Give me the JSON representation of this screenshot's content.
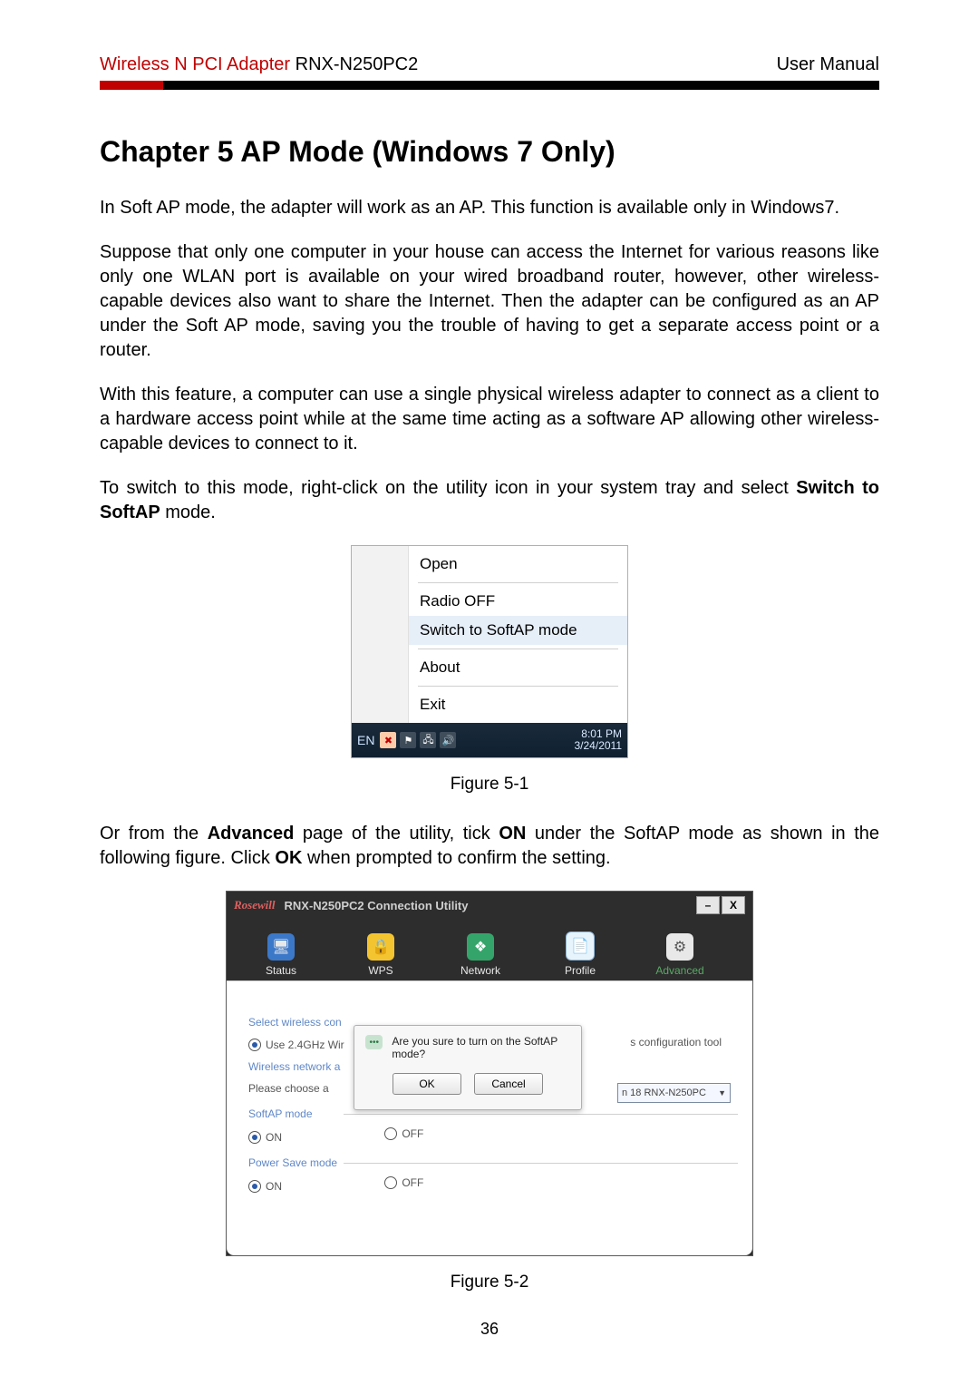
{
  "header": {
    "product_名red": "Wireless N PCI Adapter",
    "product_black": " RNX-N250PC2",
    "right": "User Manual"
  },
  "chapter_title": "Chapter 5   AP Mode (Windows 7 Only)",
  "paragraphs": {
    "p1": "In Soft AP mode, the adapter will work as an AP. This function is available only in Windows7.",
    "p2": "Suppose that only one computer in your house can access the Internet for various reasons like only one WLAN port is available on your wired broadband router, however, other wireless-capable devices also want to share the Internet. Then the adapter can be configured as an AP under the Soft AP mode, saving you the trouble of having to get a separate access point or a router.",
    "p3": "With this feature, a computer can use a single physical wireless adapter to connect as a client to a hardware access point while at the same time acting as a software AP allowing other wireless-capable devices to connect to it.",
    "p4a": "To switch to this mode, right-click on the utility icon in your system tray and select ",
    "p4b_bold": "Switch to SoftAP",
    "p4c": " mode.",
    "p5a": "Or from the ",
    "p5b_bold": "Advanced",
    "p5c": " page of the utility, tick ",
    "p5d_bold": "ON",
    "p5e": " under the SoftAP mode as shown in the following figure. Click ",
    "p5f_bold": "OK",
    "p5g": " when prompted to confirm the setting."
  },
  "fig1": {
    "menu": {
      "open": "Open",
      "radio_off": "Radio OFF",
      "switch": "Switch to SoftAP mode",
      "about": "About",
      "exit": "Exit"
    },
    "taskbar": {
      "lang": "EN",
      "time": "8:01 PM",
      "date": "3/24/2011"
    },
    "caption": "Figure 5-1"
  },
  "fig2": {
    "title": "RNX-N250PC2 Connection Utility",
    "logo": "Rosewill",
    "tabs": {
      "status": "Status",
      "wps": "WPS",
      "network": "Network",
      "profile": "Profile",
      "advanced": "Advanced"
    },
    "adv": {
      "select": "Select wireless con",
      "use24": "Use 2.4GHz Wir",
      "net_auto": "Wireless network a",
      "choose": "Please choose a",
      "softap_section": "SoftAP mode",
      "power_section": "Power Save mode",
      "on": "ON",
      "off": "OFF",
      "cfg_tool": "s configuration tool",
      "dropdown": "n 18  RNX-N250PC"
    },
    "modal": {
      "question": "Are you sure to turn on the SoftAP mode?",
      "ok": "OK",
      "cancel": "Cancel"
    },
    "caption": "Figure 5-2"
  },
  "page_number": "36"
}
